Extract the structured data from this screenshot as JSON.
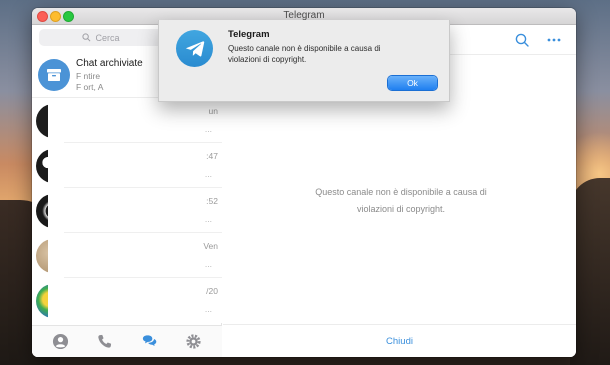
{
  "window": {
    "title": "Telegram"
  },
  "sidebar": {
    "search_placeholder": "Cerca",
    "archive": {
      "title": "Chat archiviate",
      "preview_line1": "F       ntire",
      "preview_line2": "F        ort, A"
    },
    "chats": [
      {
        "time": "un",
        "dots": "..."
      },
      {
        "time": ":47",
        "dots": "..."
      },
      {
        "time": ":52",
        "dots": "..."
      },
      {
        "time": "Ven",
        "dots": "..."
      },
      {
        "time": "/20",
        "dots": "..."
      }
    ],
    "tabs": [
      {
        "icon": "contacts-icon"
      },
      {
        "icon": "phone-icon"
      },
      {
        "icon": "chats-icon",
        "active": true
      },
      {
        "icon": "settings-icon"
      }
    ]
  },
  "main": {
    "empty_message": "Questo canale non è disponibile a causa di violazioni di copyright.",
    "footer_button": "Chiudi"
  },
  "alert": {
    "title": "Telegram",
    "message": "Questo canale non è disponibile a causa di violazioni di copyright.",
    "ok_label": "Ok"
  },
  "colors": {
    "accent": "#3a8fdc",
    "archive_avatar": "#4b93d6",
    "ok_button": "#1f7ff0"
  }
}
